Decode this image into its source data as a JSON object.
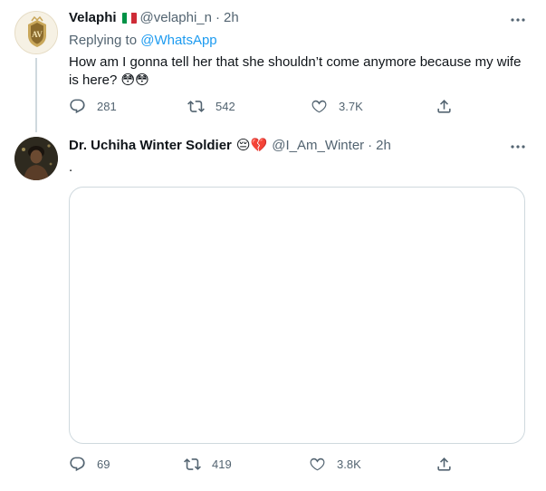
{
  "tweet1": {
    "name": "Velaphi",
    "flag": "italy-flag",
    "handle": "@velaphi_n",
    "separator": "·",
    "time": "2h",
    "replying_prefix": "Replying to ",
    "replying_to": "@WhatsApp",
    "text_line1": "How am I gonna tell her that she shouldn’t come anymore because my wife",
    "text_line2": "is here?",
    "text_emoji": "😳😳",
    "stats": {
      "replies": "281",
      "retweets": "542",
      "likes": "3.7K"
    }
  },
  "tweet2": {
    "name": "Dr. Uchiha Winter Soldier",
    "name_emoji": "😔💔",
    "handle": "@I_Am_Winter",
    "separator": "·",
    "time": "2h",
    "text": ".",
    "stats": {
      "replies": "69",
      "retweets": "419",
      "likes": "3.8K"
    }
  },
  "colors": {
    "text": "#0f1419",
    "secondary": "#536471",
    "link": "#1d9bf0",
    "border": "#cfd9de"
  }
}
